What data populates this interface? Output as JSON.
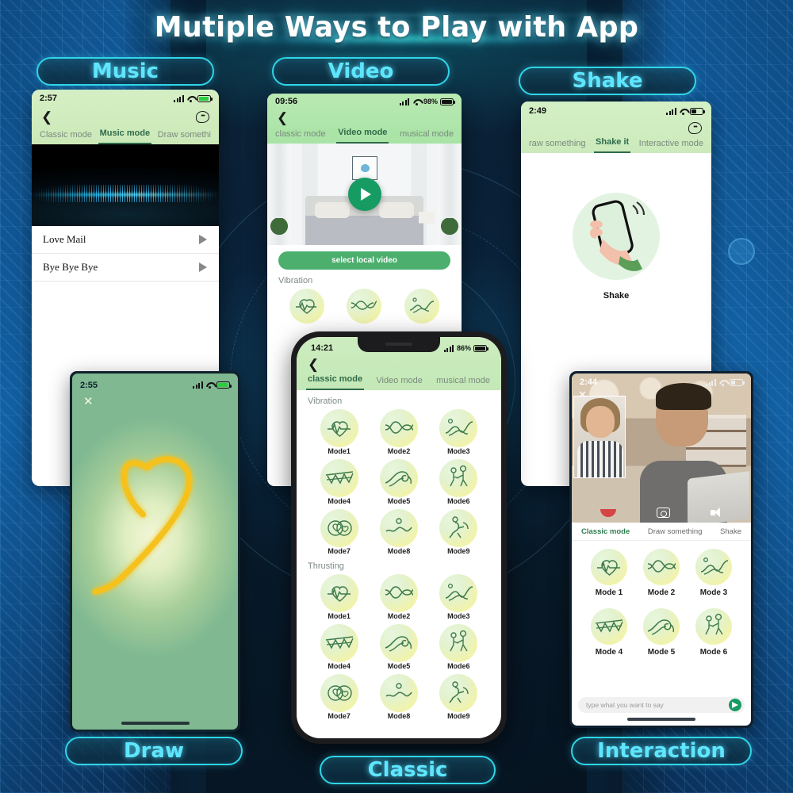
{
  "page": {
    "title": "Mutiple Ways to Play with App",
    "accent_cyan": "#5fe6ff",
    "accent_green": "#2f6b4a",
    "background_blue": "#1363a8"
  },
  "pills": {
    "music": "Music",
    "video": "Video",
    "shake": "Shake",
    "draw": "Draw",
    "classic": "Classic",
    "interaction": "Interaction"
  },
  "phones": {
    "music": {
      "status_time": "2:57",
      "tabs": [
        {
          "label": "Classic mode",
          "active": false
        },
        {
          "label": "Music mode",
          "active": true
        },
        {
          "label": "Draw somethi",
          "active": false
        }
      ],
      "songs": [
        {
          "title": "Love Mail"
        },
        {
          "title": "Bye Bye Bye"
        }
      ]
    },
    "video": {
      "status_time": "09:56",
      "status_battery": "98%",
      "tabs": [
        {
          "label": "classic mode",
          "active": false
        },
        {
          "label": "Video mode",
          "active": true
        },
        {
          "label": "musical mode",
          "active": false
        }
      ],
      "select_button": "select local video",
      "section_label": "Vibration"
    },
    "shake": {
      "status_time": "2:49",
      "tabs": [
        {
          "label": "raw something",
          "active": false
        },
        {
          "label": "Shake it",
          "active": true
        },
        {
          "label": "Interactive mode",
          "active": false
        }
      ],
      "caption": "Shake"
    },
    "classic": {
      "status_time": "14:21",
      "status_battery": "86%",
      "tabs": [
        {
          "label": "classic mode",
          "active": true
        },
        {
          "label": "Video mode",
          "active": false
        },
        {
          "label": "musical mode",
          "active": false
        }
      ],
      "sections": [
        {
          "label": "Vibration",
          "modes": [
            "Mode1",
            "Mode2",
            "Mode3",
            "Mode4",
            "Mode5",
            "Mode6",
            "Mode7",
            "Mode8",
            "Mode9"
          ]
        },
        {
          "label": "Thrusting",
          "modes": [
            "Mode1",
            "Mode2",
            "Mode3",
            "Mode4",
            "Mode5",
            "Mode6",
            "Mode7",
            "Mode8",
            "Mode9"
          ]
        }
      ]
    },
    "draw": {
      "status_time": "2:55",
      "drawing": "heart",
      "stroke_color": "#f5c11a"
    },
    "interaction": {
      "status_time": "2:44",
      "tabs": [
        {
          "label": "Classic mode",
          "active": true
        },
        {
          "label": "Draw something",
          "active": false
        },
        {
          "label": "Shake",
          "active": false
        }
      ],
      "modes": [
        "Mode 1",
        "Mode 2",
        "Mode 3",
        "Mode 4",
        "Mode 5",
        "Mode 6"
      ],
      "input_placeholder": "type what you want to say"
    }
  }
}
